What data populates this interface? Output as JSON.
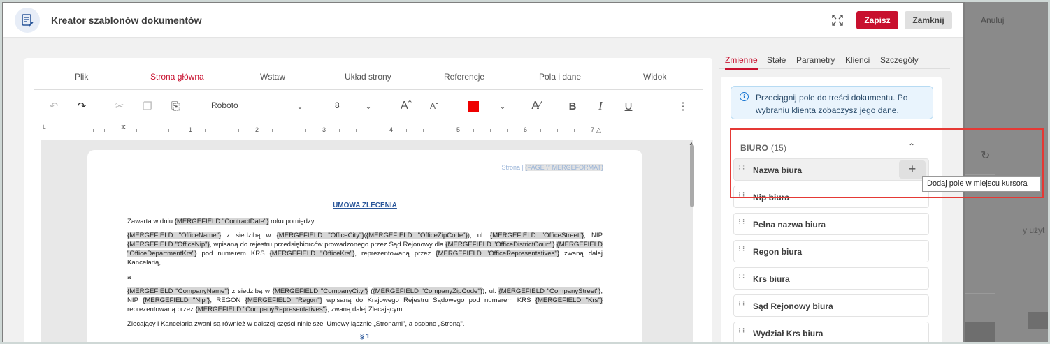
{
  "background": {
    "cancel_label": "Anuluj",
    "side_text": "y użyt"
  },
  "header": {
    "title": "Kreator szablonów dokumentów",
    "save_label": "Zapisz",
    "close_label": "Zamknij"
  },
  "editor": {
    "menu_tabs": [
      "Plik",
      "Strona główna",
      "Wstaw",
      "Układ strony",
      "Referencje",
      "Pola i dane",
      "Widok"
    ],
    "active_tab": "Strona główna",
    "font_name": "Roboto",
    "font_size": "8",
    "text_color": "#ee0000",
    "ruler_numbers": [
      "1",
      "2",
      "3",
      "4",
      "5",
      "6",
      "7"
    ]
  },
  "document": {
    "page_label": "Strona |",
    "page_field": "{PAGE \\* MERGEFORMAT}",
    "title": "UMOWA ZLECENIA",
    "p1_a": "Zawarta w dniu ",
    "p1_f": "{MERGEFIELD \"ContractDate\"}",
    "p1_b": " roku pomiędzy:",
    "p2": [
      {
        "t": "{MERGEFIELD \"OfficeName\"}",
        "f": true
      },
      {
        "t": " z siedzibą w ",
        "f": false
      },
      {
        "t": "{MERGEFIELD \"OfficeCity\"}",
        "f": true
      },
      {
        "t": "(",
        "f": false
      },
      {
        "t": "{MERGEFIELD \"OfficeZipCode\"}",
        "f": true
      },
      {
        "t": "), ul. ",
        "f": false
      },
      {
        "t": "{MERGEFIELD \"OfficeStreet\"}",
        "f": true
      },
      {
        "t": ", NIP ",
        "f": false
      },
      {
        "t": "{MERGEFIELD \"OfficeNip\"}",
        "f": true
      },
      {
        "t": ", wpisaną do rejestru przedsiębiorców prowadzonego przez Sąd Rejonowy dla ",
        "f": false
      },
      {
        "t": "{MERGEFIELD \"OfficeDistrictCourt\"}",
        "f": true
      },
      {
        "t": " ",
        "f": false
      },
      {
        "t": "{MERGEFIELD \"OfficeDepartmentKrs\"}",
        "f": true
      },
      {
        "t": " pod numerem KRS ",
        "f": false
      },
      {
        "t": "{MERGEFIELD \"OfficeKrs\"}",
        "f": true
      },
      {
        "t": ", reprezentowaną przez ",
        "f": false
      },
      {
        "t": "{MERGEFIELD \"OfficeRepresentatives\"}",
        "f": true
      },
      {
        "t": " zwaną dalej Kancelarią,",
        "f": false
      }
    ],
    "p3": "a",
    "p4": [
      {
        "t": "{MERGEFIELD \"CompanyName\"}",
        "f": true
      },
      {
        "t": " z siedzibą w ",
        "f": false
      },
      {
        "t": "{MERGEFIELD \"CompanyCity\"}",
        "f": true
      },
      {
        "t": " (",
        "f": false
      },
      {
        "t": "{MERGEFIELD \"CompanyZipCode\"}",
        "f": true
      },
      {
        "t": "), ul. ",
        "f": false
      },
      {
        "t": "{MERGEFIELD \"CompanyStreet\"}",
        "f": true
      },
      {
        "t": ", NIP ",
        "f": false
      },
      {
        "t": "{MERGEFIELD \"Nip\"}",
        "f": true
      },
      {
        "t": ", REGON ",
        "f": false
      },
      {
        "t": "{MERGEFIELD \"Regon\"}",
        "f": true
      },
      {
        "t": " wpisaną do Krajowego Rejestru Sądowego pod numerem KRS ",
        "f": false
      },
      {
        "t": "{MERGEFIELD \"Krs\"}",
        "f": true
      },
      {
        "t": " reprezentowaną przez ",
        "f": false
      },
      {
        "t": "{MERGEFIELD \"CompanyRepresentatives\"}",
        "f": true
      },
      {
        "t": ", zwaną dalej Zlecającym.",
        "f": false
      }
    ],
    "p5": "Zlecający i Kancelaria zwani są również w dalszej części niniejszej Umowy łącznie „Stronami\", a osobno „Stroną\".",
    "section": "§ 1"
  },
  "panel": {
    "tabs": [
      "Zmienne",
      "Stałe",
      "Parametry",
      "Klienci",
      "Szczegóły"
    ],
    "active_tab": "Zmienne",
    "info": "Przeciągnij pole do treści dokumentu. Po wybraniu klienta zobaczysz jego dane.",
    "group_name": "BIURO",
    "group_count": "(15)",
    "fields": [
      "Nazwa biura",
      "Nip biura",
      "Pełna nazwa biura",
      "Regon biura",
      "Krs biura",
      "Sąd Rejonowy biura",
      "Wydział Krs biura"
    ],
    "tooltip": "Dodaj pole w miejscu kursora"
  }
}
